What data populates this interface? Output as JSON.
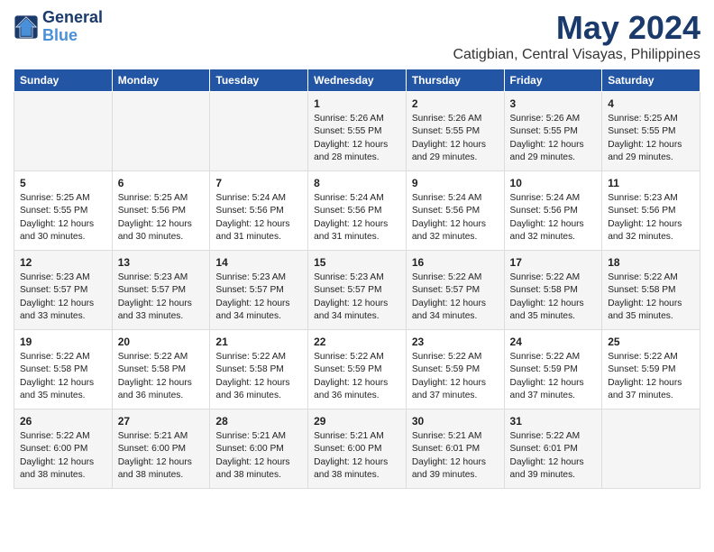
{
  "logo": {
    "line1": "General",
    "line2": "Blue"
  },
  "title": "May 2024",
  "location": "Catigbian, Central Visayas, Philippines",
  "weekdays": [
    "Sunday",
    "Monday",
    "Tuesday",
    "Wednesday",
    "Thursday",
    "Friday",
    "Saturday"
  ],
  "weeks": [
    [
      {
        "day": "",
        "info": ""
      },
      {
        "day": "",
        "info": ""
      },
      {
        "day": "",
        "info": ""
      },
      {
        "day": "1",
        "info": "Sunrise: 5:26 AM\nSunset: 5:55 PM\nDaylight: 12 hours\nand 28 minutes."
      },
      {
        "day": "2",
        "info": "Sunrise: 5:26 AM\nSunset: 5:55 PM\nDaylight: 12 hours\nand 29 minutes."
      },
      {
        "day": "3",
        "info": "Sunrise: 5:26 AM\nSunset: 5:55 PM\nDaylight: 12 hours\nand 29 minutes."
      },
      {
        "day": "4",
        "info": "Sunrise: 5:25 AM\nSunset: 5:55 PM\nDaylight: 12 hours\nand 29 minutes."
      }
    ],
    [
      {
        "day": "5",
        "info": "Sunrise: 5:25 AM\nSunset: 5:55 PM\nDaylight: 12 hours\nand 30 minutes."
      },
      {
        "day": "6",
        "info": "Sunrise: 5:25 AM\nSunset: 5:56 PM\nDaylight: 12 hours\nand 30 minutes."
      },
      {
        "day": "7",
        "info": "Sunrise: 5:24 AM\nSunset: 5:56 PM\nDaylight: 12 hours\nand 31 minutes."
      },
      {
        "day": "8",
        "info": "Sunrise: 5:24 AM\nSunset: 5:56 PM\nDaylight: 12 hours\nand 31 minutes."
      },
      {
        "day": "9",
        "info": "Sunrise: 5:24 AM\nSunset: 5:56 PM\nDaylight: 12 hours\nand 32 minutes."
      },
      {
        "day": "10",
        "info": "Sunrise: 5:24 AM\nSunset: 5:56 PM\nDaylight: 12 hours\nand 32 minutes."
      },
      {
        "day": "11",
        "info": "Sunrise: 5:23 AM\nSunset: 5:56 PM\nDaylight: 12 hours\nand 32 minutes."
      }
    ],
    [
      {
        "day": "12",
        "info": "Sunrise: 5:23 AM\nSunset: 5:57 PM\nDaylight: 12 hours\nand 33 minutes."
      },
      {
        "day": "13",
        "info": "Sunrise: 5:23 AM\nSunset: 5:57 PM\nDaylight: 12 hours\nand 33 minutes."
      },
      {
        "day": "14",
        "info": "Sunrise: 5:23 AM\nSunset: 5:57 PM\nDaylight: 12 hours\nand 34 minutes."
      },
      {
        "day": "15",
        "info": "Sunrise: 5:23 AM\nSunset: 5:57 PM\nDaylight: 12 hours\nand 34 minutes."
      },
      {
        "day": "16",
        "info": "Sunrise: 5:22 AM\nSunset: 5:57 PM\nDaylight: 12 hours\nand 34 minutes."
      },
      {
        "day": "17",
        "info": "Sunrise: 5:22 AM\nSunset: 5:58 PM\nDaylight: 12 hours\nand 35 minutes."
      },
      {
        "day": "18",
        "info": "Sunrise: 5:22 AM\nSunset: 5:58 PM\nDaylight: 12 hours\nand 35 minutes."
      }
    ],
    [
      {
        "day": "19",
        "info": "Sunrise: 5:22 AM\nSunset: 5:58 PM\nDaylight: 12 hours\nand 35 minutes."
      },
      {
        "day": "20",
        "info": "Sunrise: 5:22 AM\nSunset: 5:58 PM\nDaylight: 12 hours\nand 36 minutes."
      },
      {
        "day": "21",
        "info": "Sunrise: 5:22 AM\nSunset: 5:58 PM\nDaylight: 12 hours\nand 36 minutes."
      },
      {
        "day": "22",
        "info": "Sunrise: 5:22 AM\nSunset: 5:59 PM\nDaylight: 12 hours\nand 36 minutes."
      },
      {
        "day": "23",
        "info": "Sunrise: 5:22 AM\nSunset: 5:59 PM\nDaylight: 12 hours\nand 37 minutes."
      },
      {
        "day": "24",
        "info": "Sunrise: 5:22 AM\nSunset: 5:59 PM\nDaylight: 12 hours\nand 37 minutes."
      },
      {
        "day": "25",
        "info": "Sunrise: 5:22 AM\nSunset: 5:59 PM\nDaylight: 12 hours\nand 37 minutes."
      }
    ],
    [
      {
        "day": "26",
        "info": "Sunrise: 5:22 AM\nSunset: 6:00 PM\nDaylight: 12 hours\nand 38 minutes."
      },
      {
        "day": "27",
        "info": "Sunrise: 5:21 AM\nSunset: 6:00 PM\nDaylight: 12 hours\nand 38 minutes."
      },
      {
        "day": "28",
        "info": "Sunrise: 5:21 AM\nSunset: 6:00 PM\nDaylight: 12 hours\nand 38 minutes."
      },
      {
        "day": "29",
        "info": "Sunrise: 5:21 AM\nSunset: 6:00 PM\nDaylight: 12 hours\nand 38 minutes."
      },
      {
        "day": "30",
        "info": "Sunrise: 5:21 AM\nSunset: 6:01 PM\nDaylight: 12 hours\nand 39 minutes."
      },
      {
        "day": "31",
        "info": "Sunrise: 5:22 AM\nSunset: 6:01 PM\nDaylight: 12 hours\nand 39 minutes."
      },
      {
        "day": "",
        "info": ""
      }
    ]
  ]
}
